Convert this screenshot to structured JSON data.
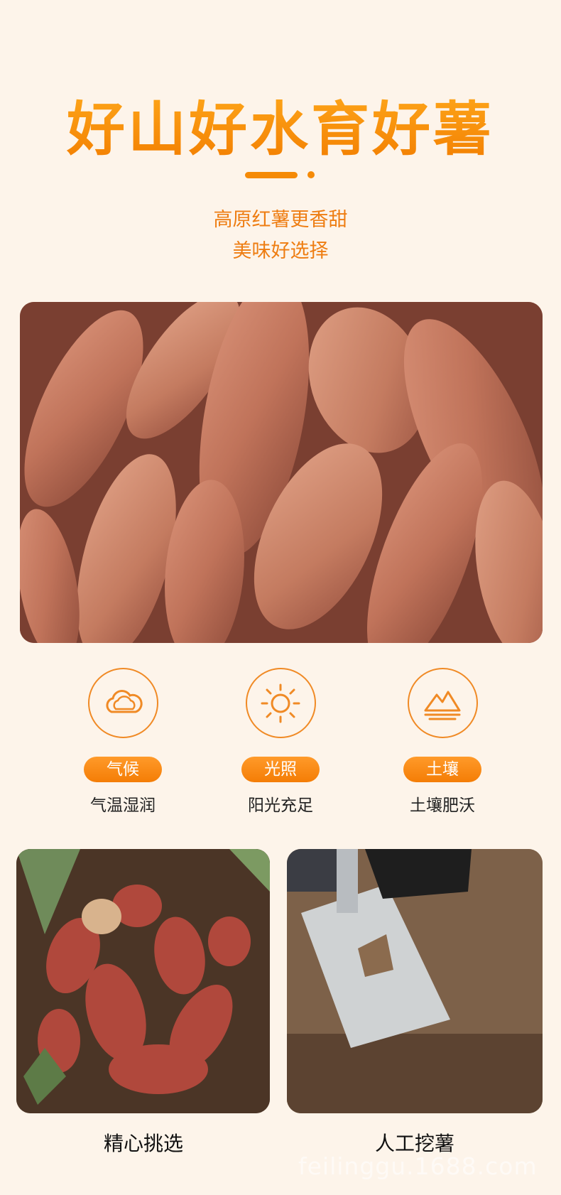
{
  "header": {
    "title": "好山好水育好薯",
    "subtitle_line1": "高原红薯更香甜",
    "subtitle_line2": "美味好选择"
  },
  "features": [
    {
      "icon": "cloud-icon",
      "label": "气候",
      "desc": "气温湿润"
    },
    {
      "icon": "sun-icon",
      "label": "光照",
      "desc": "阳光充足"
    },
    {
      "icon": "mountain-icon",
      "label": "土壤",
      "desc": "土壤肥沃"
    }
  ],
  "gallery": [
    {
      "caption": "精心挑选"
    },
    {
      "caption": "人工挖薯"
    }
  ],
  "watermark": "feilinggu.1688.com",
  "colors": {
    "accent": "#f58a07",
    "background": "#fdf4ea"
  }
}
